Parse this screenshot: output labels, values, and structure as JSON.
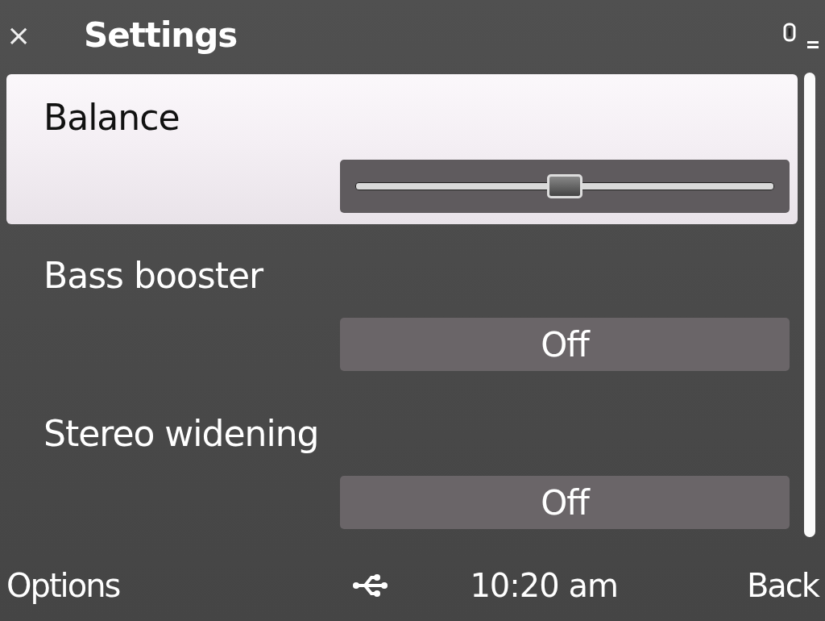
{
  "header": {
    "close": "×",
    "title": "Settings"
  },
  "settings": [
    {
      "kind": "slider",
      "label": "Balance",
      "selected": true,
      "level": 0.5
    },
    {
      "kind": "value",
      "label": "Bass booster",
      "selected": false,
      "value": "Off"
    },
    {
      "kind": "value",
      "label": "Stereo widening",
      "selected": false,
      "value": "Off"
    }
  ],
  "softkeys": {
    "left": "Options",
    "time": "10:20 am",
    "right": "Back"
  }
}
